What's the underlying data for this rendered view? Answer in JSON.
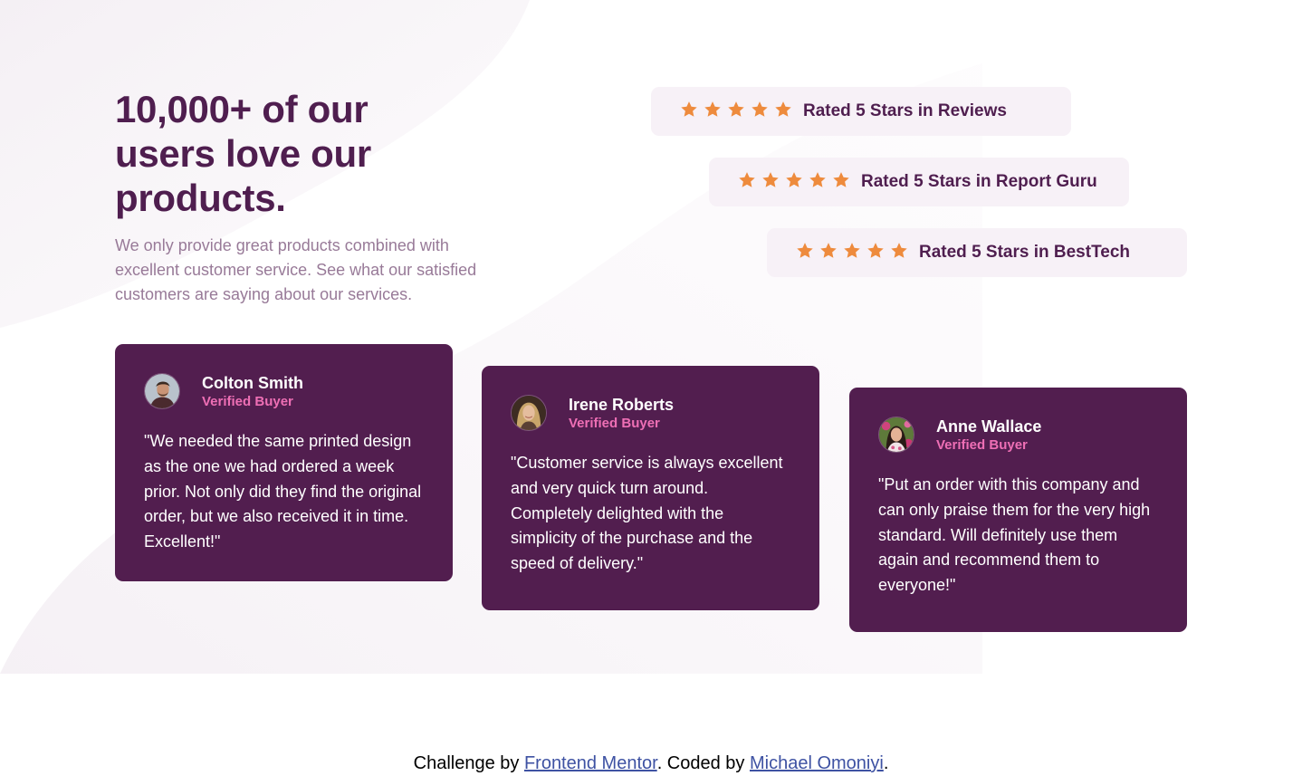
{
  "hero": {
    "heading": "10,000+ of our users love our products.",
    "description": "We only provide great products combined with excellent customer service. See what our satisfied customers are saying about our services."
  },
  "ratings": [
    {
      "stars": 5,
      "label": "Rated 5 Stars in Reviews"
    },
    {
      "stars": 5,
      "label": "Rated 5 Stars in Report Guru"
    },
    {
      "stars": 5,
      "label": "Rated 5 Stars in BestTech"
    }
  ],
  "testimonials": [
    {
      "name": "Colton Smith",
      "role": "Verified Buyer",
      "quote": "\"We needed the same printed design as the one we had ordered a week prior. Not only did they find the original order, but we also received it in time. Excellent!\"",
      "avatar_icon": "avatar-colton-icon"
    },
    {
      "name": "Irene Roberts",
      "role": "Verified Buyer",
      "quote": "\"Customer service is always excellent and very quick turn around. Completely delighted with the simplicity of the purchase and the speed of delivery.\"",
      "avatar_icon": "avatar-irene-icon"
    },
    {
      "name": "Anne Wallace",
      "role": "Verified Buyer",
      "quote": "\"Put an order with this company and can only praise them for the very high standard. Will definitely use them again and recommend them to everyone!\"",
      "avatar_icon": "avatar-anne-icon"
    }
  ],
  "footer": {
    "prefix": "Challenge by ",
    "link1": "Frontend Mentor",
    "middle": ". Coded by ",
    "link2": "Michael Omoniyi",
    "suffix": "."
  },
  "colors": {
    "heading": "#4f1e4f",
    "body_text": "#987a98",
    "rating_bg": "#f7f1f7",
    "star": "#ee8b3d",
    "card_bg": "#521e4f",
    "accent_pink": "#ee6fb5",
    "link": "#3e52a3"
  },
  "icons": {
    "star": "star-icon"
  }
}
